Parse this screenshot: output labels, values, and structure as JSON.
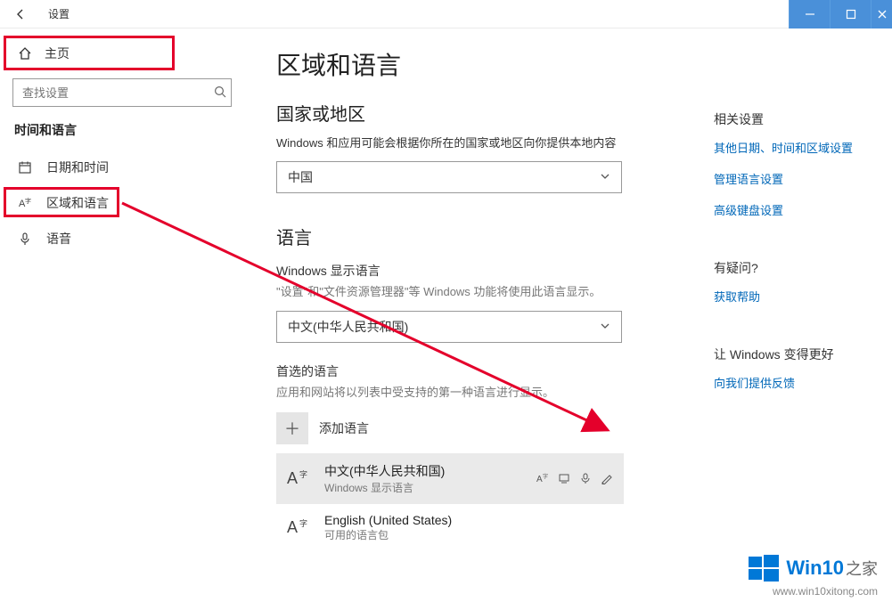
{
  "titlebar": {
    "app_title": "设置"
  },
  "sidebar": {
    "home": "主页",
    "search_placeholder": "查找设置",
    "group_title": "时间和语言",
    "items": [
      {
        "label": "日期和时间"
      },
      {
        "label": "区域和语言"
      },
      {
        "label": "语音"
      }
    ]
  },
  "main": {
    "page_title": "区域和语言",
    "region": {
      "heading": "国家或地区",
      "desc": "Windows 和应用可能会根据你所在的国家或地区向你提供本地内容",
      "select_value": "中国"
    },
    "language": {
      "heading": "语言",
      "display_label": "Windows 显示语言",
      "display_desc": "\"设置\"和\"文件资源管理器\"等 Windows 功能将使用此语言显示。",
      "display_value": "中文(中华人民共和国)",
      "preferred_label": "首选的语言",
      "preferred_desc": "应用和网站将以列表中受支持的第一种语言进行显示。",
      "add_label": "添加语言",
      "items": [
        {
          "name": "中文(中华人民共和国)",
          "sub": "Windows 显示语言"
        },
        {
          "name": "English (United States)",
          "sub": "可用的语言包"
        }
      ]
    }
  },
  "aside": {
    "related_heading": "相关设置",
    "links": [
      "其他日期、时间和区域设置",
      "管理语言设置",
      "高级键盘设置"
    ],
    "question_heading": "有疑问?",
    "help_link": "获取帮助",
    "improve_heading": "让 Windows 变得更好",
    "feedback_link": "向我们提供反馈"
  },
  "watermark": {
    "title_main": "Win10",
    "title_suffix": "之家",
    "url": "www.win10xitong.com"
  }
}
